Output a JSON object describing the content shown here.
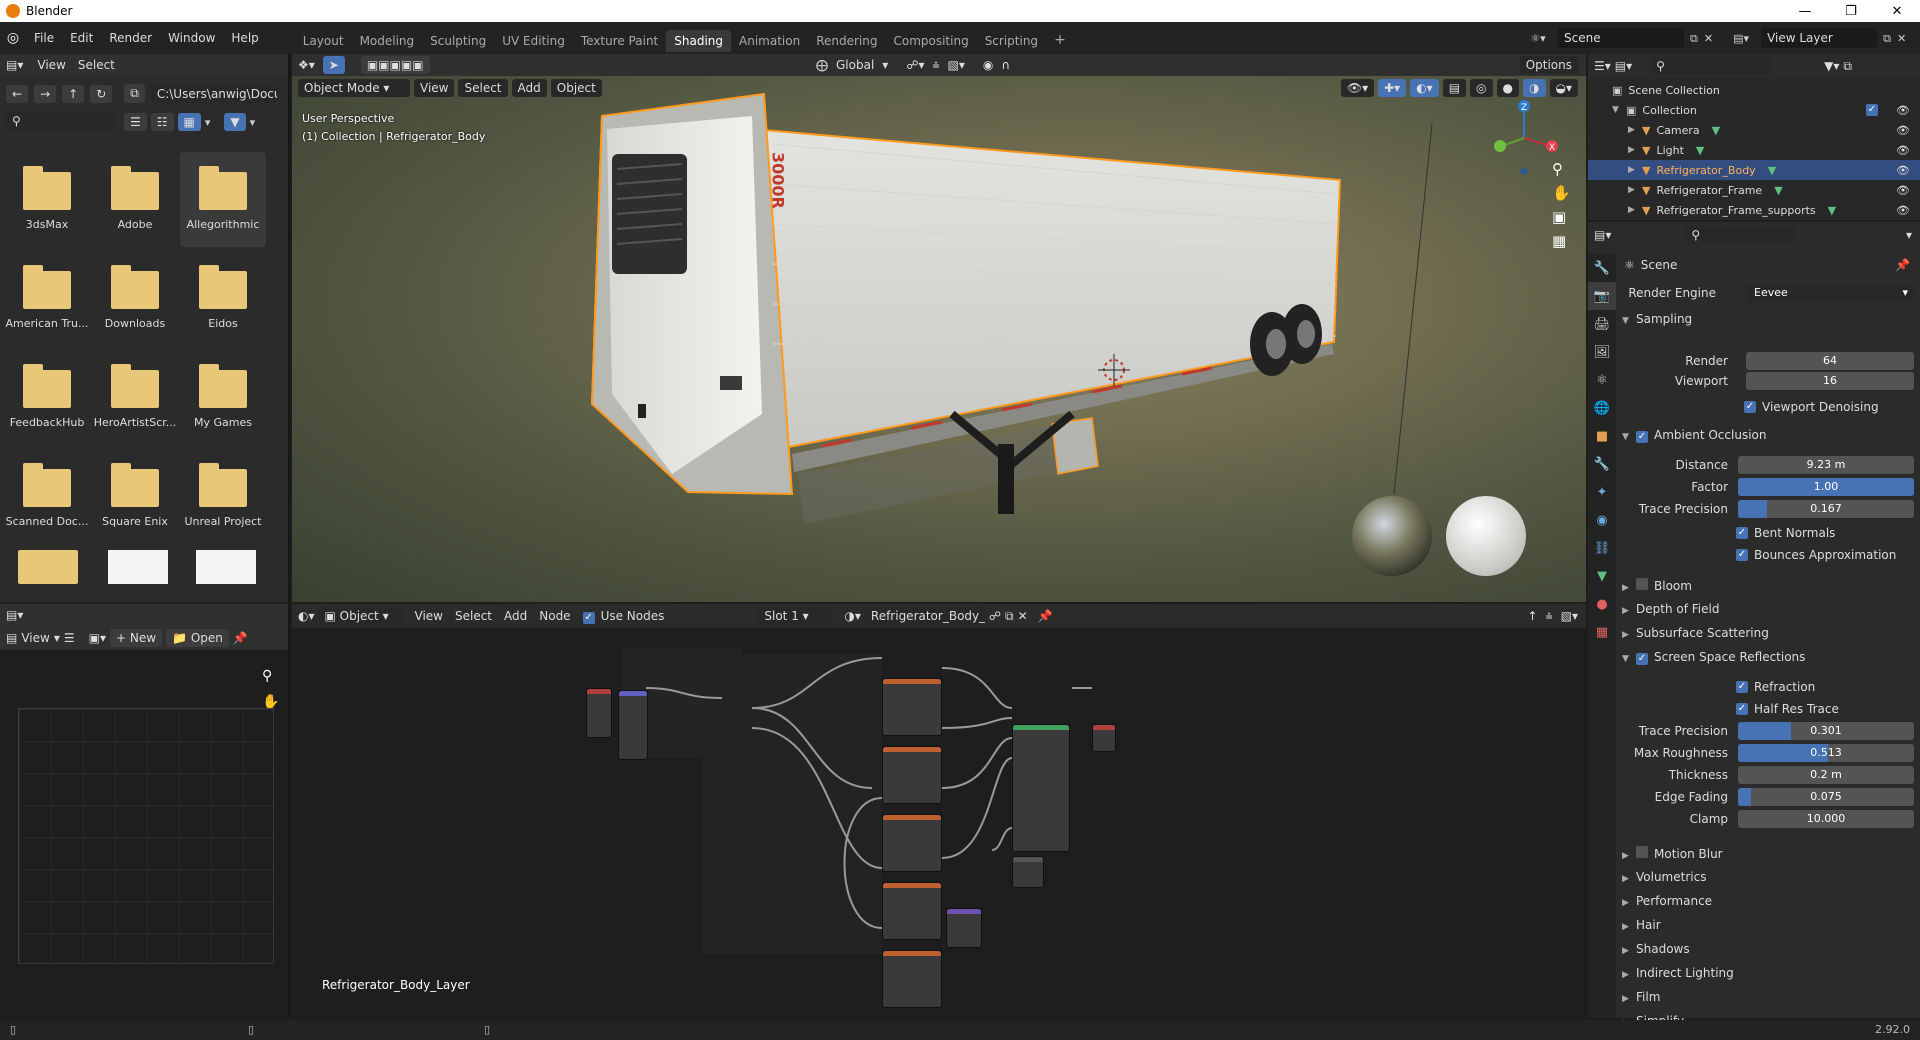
{
  "window": {
    "title": "Blender"
  },
  "menu": [
    "File",
    "Edit",
    "Render",
    "Window",
    "Help"
  ],
  "workspaces": [
    "Layout",
    "Modeling",
    "Sculpting",
    "UV Editing",
    "Texture Paint",
    "Shading",
    "Animation",
    "Rendering",
    "Compositing",
    "Scripting"
  ],
  "active_workspace": "Shading",
  "scene": {
    "name": "Scene",
    "view_layer": "View Layer"
  },
  "file_browser": {
    "header": [
      "View",
      "Select"
    ],
    "path": "C:\\Users\\anwig\\Docu...",
    "folders": [
      "3dsMax",
      "Adobe",
      "Allegorithmic",
      "American Tru...",
      "Downloads",
      "Eidos",
      "FeedbackHub",
      "HeroArtistScr...",
      "My Games",
      "Scanned Doc...",
      "Square Enix",
      "Unreal Project"
    ],
    "selected_folder": "Allegorithmic"
  },
  "viewport": {
    "mode": "Object Mode",
    "menus": [
      "View",
      "Select",
      "Add",
      "Object"
    ],
    "transform_orientation": "Global",
    "options": "Options",
    "perspective_label": "User Perspective",
    "collection_label": "(1) Collection | Refrigerator_Body",
    "trailer_text": "3000R",
    "gizmo": {
      "x": "X",
      "y": "Y",
      "z": "Z"
    }
  },
  "image_editor": {
    "view": "View",
    "new": "New",
    "open": "Open"
  },
  "node_editor": {
    "type": "Object",
    "menus": [
      "View",
      "Select",
      "Add",
      "Node"
    ],
    "use_nodes": "Use Nodes",
    "slot": "Slot 1",
    "material": "Refrigerator_Body_L...",
    "material_label": "Refrigerator_Body_Layer"
  },
  "outliner": {
    "root": "Scene Collection",
    "collection": "Collection",
    "items": [
      {
        "name": "Camera",
        "color": "#e0a050"
      },
      {
        "name": "Light",
        "color": "#e0a050"
      },
      {
        "name": "Refrigerator_Body",
        "color": "#e0a050",
        "selected": true
      },
      {
        "name": "Refrigerator_Frame",
        "color": "#e0a050"
      },
      {
        "name": "Refrigerator_Frame_supports",
        "color": "#e0a050"
      }
    ]
  },
  "properties": {
    "context": "Scene",
    "render_engine_label": "Render Engine",
    "render_engine": "Eevee",
    "sampling": {
      "title": "Sampling",
      "render_label": "Render",
      "render": "64",
      "viewport_label": "Viewport",
      "viewport": "16",
      "denoise": "Viewport Denoising"
    },
    "ao": {
      "title": "Ambient Occlusion",
      "distance_label": "Distance",
      "distance": "9.23 m",
      "factor_label": "Factor",
      "factor": "1.00",
      "factor_fill": 1.0,
      "trace_label": "Trace Precision",
      "trace": "0.167",
      "trace_fill": 0.167,
      "bent": "Bent Normals",
      "bounces": "Bounces Approximation"
    },
    "bloom": "Bloom",
    "dof": "Depth of Field",
    "sss": "Subsurface Scattering",
    "ssr": {
      "title": "Screen Space Reflections",
      "refraction": "Refraction",
      "half_res": "Half Res Trace",
      "trace_label": "Trace Precision",
      "trace": "0.301",
      "trace_fill": 0.301,
      "rough_label": "Max Roughness",
      "rough": "0.513",
      "rough_fill": 0.513,
      "thick_label": "Thickness",
      "thick": "0.2 m",
      "edge_label": "Edge Fading",
      "edge": "0.075",
      "edge_fill": 0.075,
      "clamp_label": "Clamp",
      "clamp": "10.000"
    },
    "collapsed": [
      "Motion Blur",
      "Volumetrics",
      "Performance",
      "Hair",
      "Shadows",
      "Indirect Lighting",
      "Film",
      "Simplify"
    ]
  },
  "status": {
    "version": "2.92.0"
  },
  "colors": {
    "accent": "#4772b3",
    "selection_orange": "#ff9a1e",
    "bg": "#2b2b2b"
  }
}
